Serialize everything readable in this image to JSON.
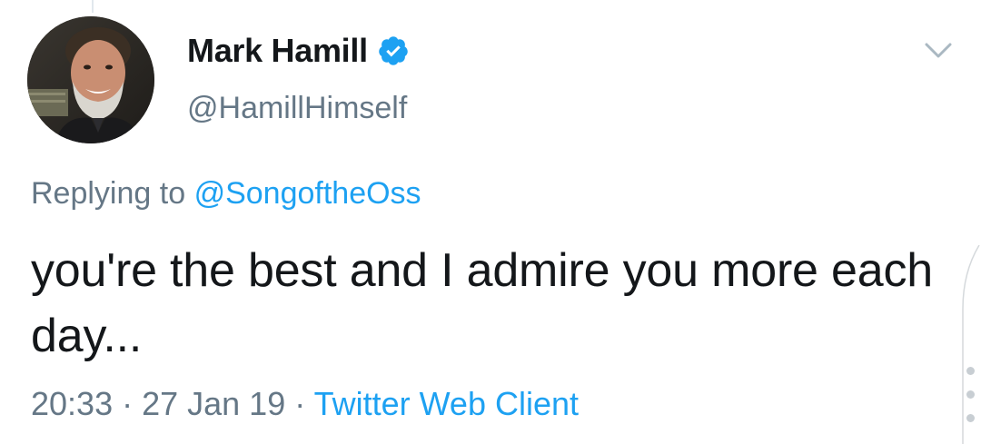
{
  "tweet": {
    "author": {
      "display_name": "Mark Hamill",
      "handle": "@HamillHimself",
      "verified": true,
      "avatar_icon": "user-avatar-photo"
    },
    "reply": {
      "prefix": "Replying to",
      "mention": "@SongoftheOss"
    },
    "text": "you're the best and I admire you more each day...",
    "meta": {
      "time": "20:33",
      "separator_1": " · ",
      "date": "27 Jan 19",
      "separator_2": " · ",
      "source": "Twitter Web Client"
    },
    "menu_icon": "chevron-down-icon"
  },
  "colors": {
    "text_primary": "#14171a",
    "text_secondary": "#657786",
    "accent": "#1da1f2",
    "verified_badge": "#1da1f2"
  }
}
